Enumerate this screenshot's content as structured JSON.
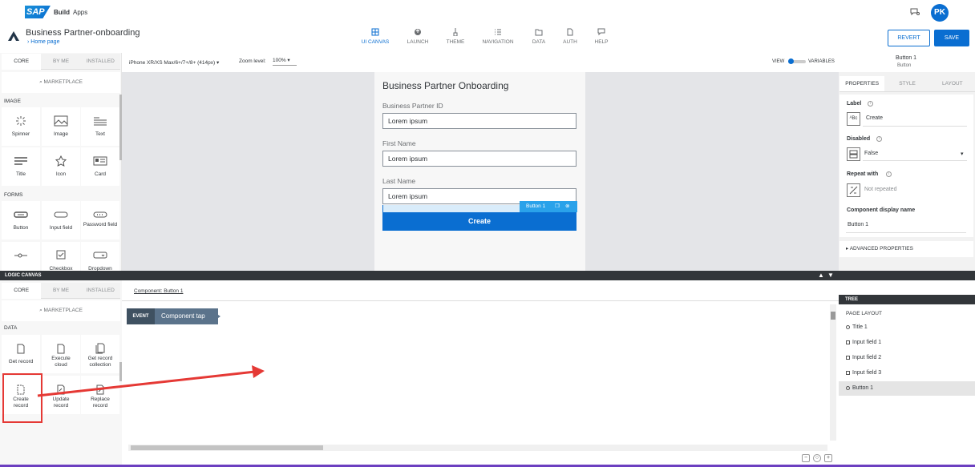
{
  "topbar": {
    "brand": "SAP",
    "product": "Build",
    "section": "Apps",
    "avatar": "PK"
  },
  "header": {
    "app_title": "Business Partner-onboarding",
    "home_link": "Home page",
    "revert": "REVERT",
    "save": "SAVE",
    "nav": [
      {
        "label": "UI CANVAS",
        "icon": "grid-icon"
      },
      {
        "label": "LAUNCH",
        "icon": "launch-icon"
      },
      {
        "label": "THEME",
        "icon": "brush-icon"
      },
      {
        "label": "NAVIGATION",
        "icon": "list-icon"
      },
      {
        "label": "DATA",
        "icon": "folder-icon"
      },
      {
        "label": "AUTH",
        "icon": "document-icon"
      },
      {
        "label": "HELP",
        "icon": "chat-icon"
      }
    ]
  },
  "components_panel": {
    "tabs": [
      "CORE",
      "BY ME",
      "INSTALLED"
    ],
    "marketplace": "MARKETPLACE",
    "sections": [
      {
        "title": "IMAGE",
        "items": [
          "Spinner",
          "Image",
          "Text",
          "Title",
          "Icon",
          "Card"
        ]
      },
      {
        "title": "FORMS",
        "items": [
          "Button",
          "Input field",
          "Password field",
          "",
          "Checkbox",
          "Dropdown"
        ]
      }
    ]
  },
  "canvas": {
    "device": "iPhone XR/XS Max/6+/7+/8+ (414px)",
    "zoom_label": "Zoom level:",
    "zoom_value": "100%",
    "view_label": "VIEW",
    "variables_label": "VARIABLES",
    "form": {
      "title": "Business Partner Onboarding",
      "fields": [
        {
          "label": "Business Partner ID",
          "value": "Lorem ipsum"
        },
        {
          "label": "First Name",
          "value": "Lorem ipsum"
        },
        {
          "label": "Last Name",
          "value": "Lorem ipsum"
        }
      ],
      "button": "Create",
      "selection_tag": "Button 1"
    }
  },
  "properties_panel": {
    "component_name": "Button 1",
    "component_type": "Button",
    "tabs": [
      "PROPERTIES",
      "STYLE",
      "LAYOUT"
    ],
    "label_title": "Label",
    "label_value": "Create",
    "disabled_title": "Disabled",
    "disabled_value": "False",
    "repeat_title": "Repeat with",
    "repeat_value": "Not repeated",
    "display_name_title": "Component display name",
    "display_name_value": "Button 1",
    "advanced": "ADVANCED PROPERTIES"
  },
  "logic_canvas": {
    "title": "LOGIC CANVAS",
    "tabs": [
      "CORE",
      "BY ME",
      "INSTALLED"
    ],
    "marketplace": "MARKETPLACE",
    "section": "DATA",
    "items": [
      [
        "Get record"
      ],
      [
        "Execute",
        "cloud"
      ],
      [
        "Get record",
        "collection"
      ],
      [
        "Create",
        "record"
      ],
      [
        "Update",
        "record"
      ],
      [
        "Replace",
        "record"
      ]
    ],
    "component_link": "Component: Button 1",
    "event_tag": "EVENT",
    "event_name": "Component tap"
  },
  "tree": {
    "title": "TREE",
    "header": "PAGE LAYOUT",
    "items": [
      "Title 1",
      "Input field 1",
      "Input field 2",
      "Input field 3",
      "Button 1"
    ]
  },
  "colors": {
    "accent": "#0a6ed1",
    "highlight": "#e53935"
  }
}
